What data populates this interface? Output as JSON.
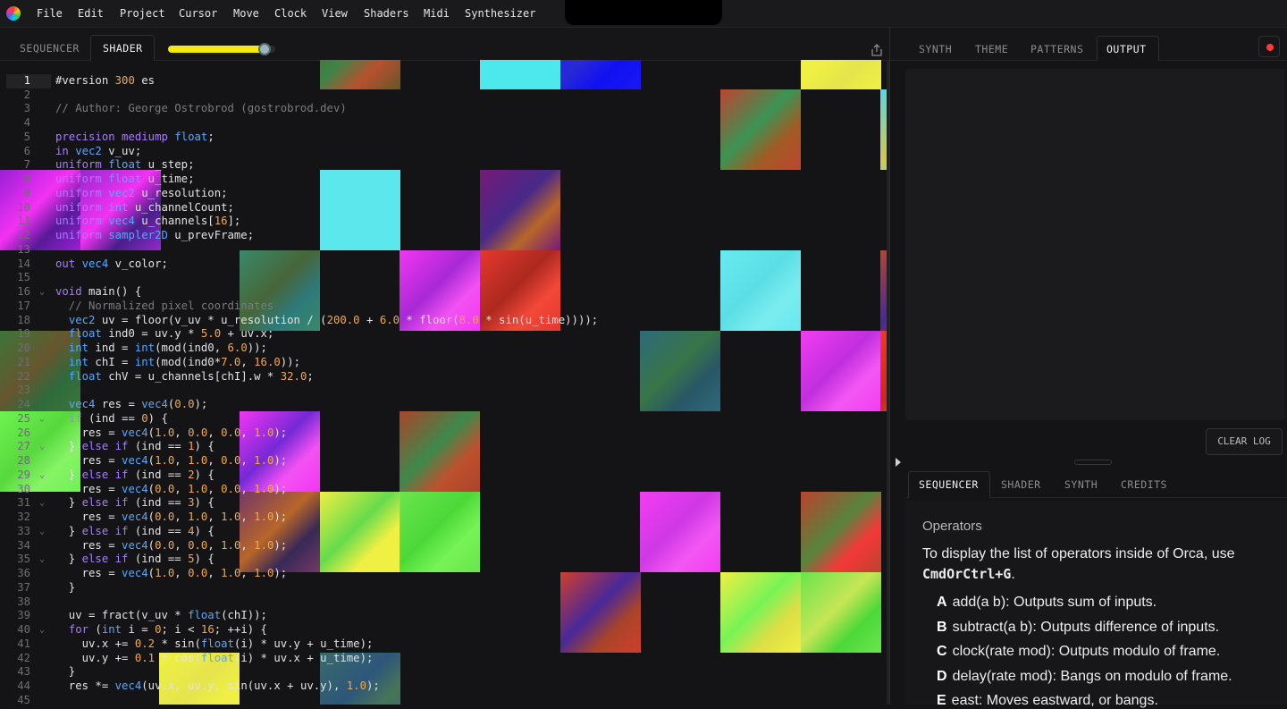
{
  "menu": [
    "File",
    "Edit",
    "Project",
    "Cursor",
    "Move",
    "Clock",
    "View",
    "Shaders",
    "Midi",
    "Synthesizer"
  ],
  "editor_tabs": [
    "SEQUENCER",
    "SHADER"
  ],
  "active_editor_tab": "SHADER",
  "speed_slider_value": 0.9,
  "right_tabs": [
    "SYNTH",
    "THEME",
    "PATTERNS",
    "OUTPUT"
  ],
  "active_right_tab": "OUTPUT",
  "clear_log_label": "CLEAR LOG",
  "lower_tabs": [
    "SEQUENCER",
    "SHADER",
    "SYNTH",
    "CREDITS"
  ],
  "active_lower_tab": "SEQUENCER",
  "docs": {
    "heading": "Operators",
    "intro_text": "To display the list of operators inside of Orca, use",
    "intro_shortcut": "CmdOrCtrl+G",
    "intro_end": ".",
    "operators": [
      {
        "key": "A",
        "text": "add(a b): Outputs sum of inputs."
      },
      {
        "key": "B",
        "text": "subtract(a b): Outputs difference of inputs."
      },
      {
        "key": "C",
        "text": "clock(rate mod): Outputs modulo of frame."
      },
      {
        "key": "D",
        "text": "delay(rate mod): Bangs on modulo of frame."
      },
      {
        "key": "E",
        "text": "east: Moves eastward, or bangs."
      }
    ]
  },
  "accent_colors": {
    "slider": "#f3ea0e",
    "record": "#ff3b30"
  },
  "code": {
    "current_line": 1,
    "lines": [
      {
        "n": "1",
        "fold": "",
        "src": "#version 300 es"
      },
      {
        "n": "2",
        "fold": "",
        "src": ""
      },
      {
        "n": "3",
        "fold": "",
        "src": "// Author: George Ostrobrod (gostrobrod.dev)"
      },
      {
        "n": "4",
        "fold": "",
        "src": ""
      },
      {
        "n": "5",
        "fold": "",
        "src": "precision mediump float;"
      },
      {
        "n": "6",
        "fold": "",
        "src": "in vec2 v_uv;"
      },
      {
        "n": "7",
        "fold": "",
        "src": "uniform float u_step;"
      },
      {
        "n": "8",
        "fold": "",
        "src": "uniform float u_time;"
      },
      {
        "n": "9",
        "fold": "",
        "src": "uniform vec2 u_resolution;"
      },
      {
        "n": "10",
        "fold": "",
        "src": "uniform int u_channelCount;"
      },
      {
        "n": "11",
        "fold": "",
        "src": "uniform vec4 u_channels[16];"
      },
      {
        "n": "12",
        "fold": "",
        "src": "uniform sampler2D u_prevFrame;"
      },
      {
        "n": "13",
        "fold": "",
        "src": ""
      },
      {
        "n": "14",
        "fold": "",
        "src": "out vec4 v_color;"
      },
      {
        "n": "15",
        "fold": "",
        "src": ""
      },
      {
        "n": "16",
        "fold": "⌄",
        "src": "void main() {"
      },
      {
        "n": "17",
        "fold": "",
        "src": "  // Normalized pixel coordinates"
      },
      {
        "n": "18",
        "fold": "",
        "src": "  vec2 uv = floor(v_uv * u_resolution / (200.0 + 6.0 * floor(8.0 * sin(u_time))));"
      },
      {
        "n": "19",
        "fold": "",
        "src": "  float ind0 = uv.y * 5.0 + uv.x;"
      },
      {
        "n": "20",
        "fold": "",
        "src": "  int ind = int(mod(ind0, 6.0));"
      },
      {
        "n": "21",
        "fold": "",
        "src": "  int chI = int(mod(ind0*7.0, 16.0));"
      },
      {
        "n": "22",
        "fold": "",
        "src": "  float chV = u_channels[chI].w * 32.0;"
      },
      {
        "n": "23",
        "fold": "",
        "src": ""
      },
      {
        "n": "24",
        "fold": "",
        "src": "  vec4 res = vec4(0.0);"
      },
      {
        "n": "25",
        "fold": "⌄",
        "src": "  if (ind == 0) {"
      },
      {
        "n": "26",
        "fold": "",
        "src": "    res = vec4(1.0, 0.0, 0.0, 1.0);"
      },
      {
        "n": "27",
        "fold": "⌄",
        "src": "  } else if (ind == 1) {"
      },
      {
        "n": "28",
        "fold": "",
        "src": "    res = vec4(1.0, 1.0, 0.0, 1.0);"
      },
      {
        "n": "29",
        "fold": "⌄",
        "src": "  } else if (ind == 2) {"
      },
      {
        "n": "30",
        "fold": "",
        "src": "    res = vec4(0.0, 1.0, 0.0, 1.0);"
      },
      {
        "n": "31",
        "fold": "⌄",
        "src": "  } else if (ind == 3) {"
      },
      {
        "n": "32",
        "fold": "",
        "src": "    res = vec4(0.0, 1.0, 1.0, 1.0);"
      },
      {
        "n": "33",
        "fold": "⌄",
        "src": "  } else if (ind == 4) {"
      },
      {
        "n": "34",
        "fold": "",
        "src": "    res = vec4(0.0, 0.0, 1.0, 1.0);"
      },
      {
        "n": "35",
        "fold": "⌄",
        "src": "  } else if (ind == 5) {"
      },
      {
        "n": "36",
        "fold": "",
        "src": "    res = vec4(1.0, 0.0, 1.0, 1.0);"
      },
      {
        "n": "37",
        "fold": "",
        "src": "  }"
      },
      {
        "n": "38",
        "fold": "",
        "src": ""
      },
      {
        "n": "39",
        "fold": "",
        "src": "  uv = fract(v_uv * float(chI));"
      },
      {
        "n": "40",
        "fold": "⌄",
        "src": "  for (int i = 0; i < 16; ++i) {"
      },
      {
        "n": "41",
        "fold": "",
        "src": "    uv.x += 0.2 * sin(float(i) * uv.y + u_time);"
      },
      {
        "n": "42",
        "fold": "",
        "src": "    uv.y += 0.1 * cos(float(i) * uv.x + u_time);"
      },
      {
        "n": "43",
        "fold": "",
        "src": "  }"
      },
      {
        "n": "44",
        "fold": "",
        "src": "  res *= vec4(uv.x, uv.y, sin(uv.x + uv.y), 1.0);"
      },
      {
        "n": "45",
        "fold": "",
        "src": ""
      }
    ]
  }
}
